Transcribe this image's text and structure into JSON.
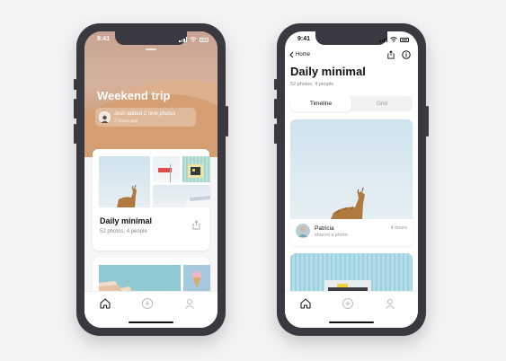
{
  "left_phone": {
    "status": {
      "time": "9:41"
    },
    "hero": {
      "title": "Weekend trip",
      "activity_text": "Josh added 2 new photos",
      "activity_time": "2 hours ago"
    },
    "album_card": {
      "title": "Daily minimal",
      "subtitle": "52 photos, 4 people"
    },
    "tabbar": {
      "icons": [
        "home-icon",
        "add-icon",
        "profile-icon"
      ]
    }
  },
  "right_phone": {
    "status": {
      "time": "9:41"
    },
    "nav": {
      "back_label": "Home"
    },
    "album": {
      "title": "Daily minimal",
      "subtitle": "52 photos, 4 people"
    },
    "segments": {
      "timeline": "Timeline",
      "grid": "Grid",
      "selected": "Timeline"
    },
    "post": {
      "author": "Patricia",
      "action": "shared a photo",
      "time": "4 hours"
    },
    "tabbar": {
      "icons": [
        "home-icon",
        "add-icon",
        "profile-icon"
      ]
    }
  },
  "colors": {
    "phone_frame": "#3a3941",
    "background": "#f3f2f4",
    "sky": "#cfe3ee",
    "desert": "#d59f73"
  }
}
